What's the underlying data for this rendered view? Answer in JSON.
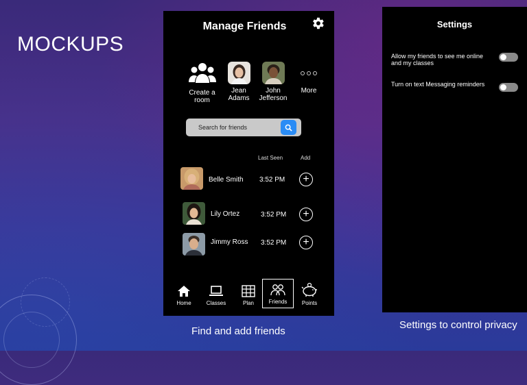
{
  "slide": {
    "title": "MOCKUPS",
    "caption_left": "Find and add friends",
    "caption_right": "Settings to control privacy"
  },
  "friends_screen": {
    "title": "Manage Friends",
    "quick_actions": [
      {
        "label_line1": "Create a",
        "label_line2": "room",
        "icon": "group-icon"
      },
      {
        "label_line1": "Jean",
        "label_line2": "Adams",
        "icon": "avatar"
      },
      {
        "label_line1": "John",
        "label_line2": "Jefferson",
        "icon": "avatar"
      },
      {
        "label_line1": "More",
        "label_line2": "",
        "icon": "more-icon"
      }
    ],
    "search": {
      "placeholder": "Search for friends"
    },
    "columns": {
      "last_seen": "Last Seen",
      "add": "Add"
    },
    "friends": [
      {
        "name": "Belle Smith",
        "last_seen": "3:52 PM"
      },
      {
        "name": "Lily Ortez",
        "last_seen": "3:52 PM"
      },
      {
        "name": "Jimmy Ross",
        "last_seen": "3:52 PM"
      }
    ],
    "nav": [
      {
        "label": "Home",
        "icon": "home-icon"
      },
      {
        "label": "Classes",
        "icon": "laptop-icon"
      },
      {
        "label": "Plan",
        "icon": "calendar-grid-icon"
      },
      {
        "label": "Friends",
        "icon": "friends-icon",
        "active": true
      },
      {
        "label": "Points",
        "icon": "piggy-bank-icon"
      }
    ]
  },
  "settings_screen": {
    "title": "Settings",
    "options": [
      {
        "label_line1": "Allow my friends to see me online",
        "label_line2": "and my classes",
        "enabled": false
      },
      {
        "label_line1": "Turn on text Messaging reminders",
        "label_line2": "",
        "enabled": false
      }
    ]
  },
  "colors": {
    "accent": "#2a8cf5",
    "screen_bg": "#000000",
    "search_bg": "#c9c9c9",
    "toggle_off": "#8a8a8a"
  }
}
